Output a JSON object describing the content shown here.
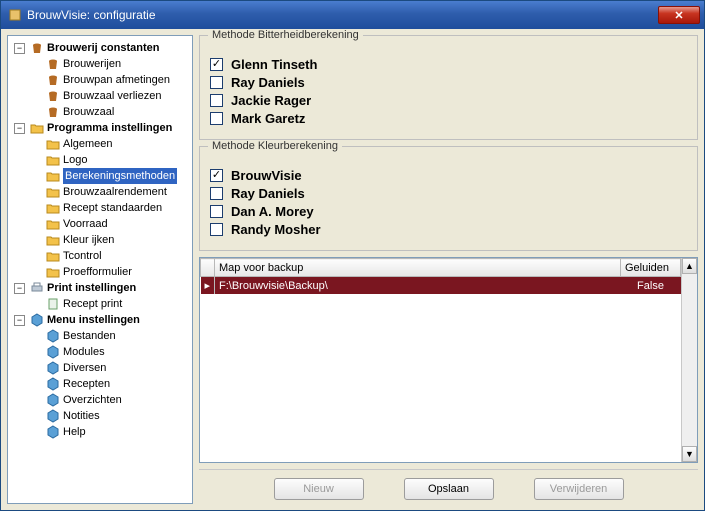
{
  "window": {
    "title": "BrouwVisie: configuratie"
  },
  "tree": {
    "brewery": {
      "label": "Brouwerij constanten",
      "children": [
        "Brouwerijen",
        "Brouwpan afmetingen",
        "Brouwzaal verliezen",
        "Brouwzaal"
      ]
    },
    "program": {
      "label": "Programma instellingen",
      "children": [
        "Algemeen",
        "Logo",
        "Berekeningsmethoden",
        "Brouwzaalrendement",
        "Recept standaarden",
        "Voorraad",
        "Kleur ijken",
        "Tcontrol",
        "Proefformulier"
      ]
    },
    "print": {
      "label": "Print instellingen",
      "children": [
        "Recept print"
      ]
    },
    "menu": {
      "label": "Menu instellingen",
      "children": [
        "Bestanden",
        "Modules",
        "Diversen",
        "Recepten",
        "Overzichten",
        "Notities",
        "Help"
      ]
    },
    "selected": "Berekeningsmethoden"
  },
  "bitter": {
    "legend": "Methode Bitterheidberekening",
    "options": [
      {
        "label": "Glenn Tinseth",
        "checked": true
      },
      {
        "label": "Ray Daniels",
        "checked": false
      },
      {
        "label": "Jackie Rager",
        "checked": false
      },
      {
        "label": "Mark Garetz",
        "checked": false
      }
    ]
  },
  "color": {
    "legend": "Methode Kleurberekening",
    "options": [
      {
        "label": "BrouwVisie",
        "checked": true
      },
      {
        "label": "Ray Daniels",
        "checked": false
      },
      {
        "label": "Dan A. Morey",
        "checked": false
      },
      {
        "label": "Randy Mosher",
        "checked": false
      }
    ]
  },
  "grid": {
    "columns": [
      "Map voor backup",
      "Geluiden"
    ],
    "rows": [
      {
        "path": "F:\\Brouwvisie\\Backup\\",
        "sound": "False"
      }
    ]
  },
  "buttons": {
    "new": "Nieuw",
    "save": "Opslaan",
    "delete": "Verwijderen"
  }
}
